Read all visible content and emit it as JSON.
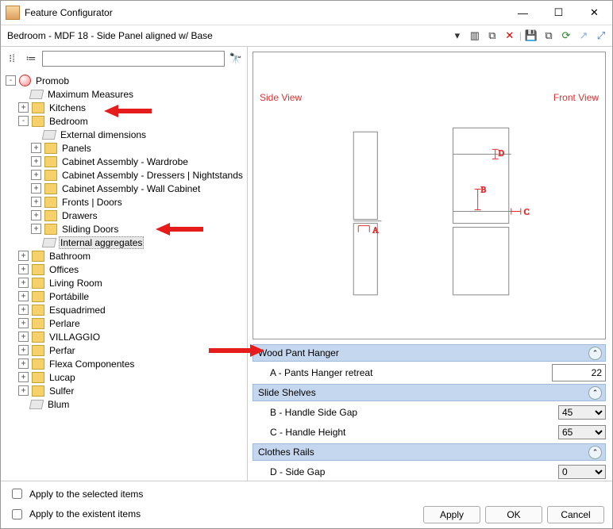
{
  "title": "Feature Configurator",
  "path": "Bedroom - MDF 18 - Side Panel aligned w/ Base",
  "search_placeholder": "",
  "tree": {
    "root": "Promob",
    "items": [
      "Maximum Measures",
      "Kitchens",
      "Bedroom",
      "External dimensions",
      "Panels",
      "Cabinet Assembly - Wardrobe",
      "Cabinet Assembly - Dressers | Nightstands",
      "Cabinet Assembly - Wall Cabinet",
      "Fronts | Doors",
      "Drawers",
      "Sliding Doors",
      "Internal aggregates",
      "Bathroom",
      "Offices",
      "Living Room",
      "Portábille",
      "Esquadrimed",
      "Perlare",
      "VILLAGGIO",
      "Perfar",
      "Flexa Componentes",
      "Lucap",
      "Sulfer",
      "Blum"
    ]
  },
  "preview": {
    "side": "Side View",
    "front": "Front View",
    "labels": [
      "A",
      "B",
      "C",
      "D"
    ]
  },
  "sections": [
    {
      "title": "Wood Pant Hanger",
      "rows": [
        {
          "label": "A - Pants Hanger retreat",
          "value": "22",
          "type": "input"
        }
      ]
    },
    {
      "title": "Slide Shelves",
      "rows": [
        {
          "label": "B - Handle Side Gap",
          "value": "45",
          "type": "select"
        },
        {
          "label": "C - Handle Height",
          "value": "65",
          "type": "select"
        }
      ]
    },
    {
      "title": "Clothes Rails",
      "rows": [
        {
          "label": "D - Side Gap",
          "value": "0",
          "type": "select"
        }
      ]
    }
  ],
  "apply_selected": "Apply to the selected items",
  "apply_existent": "Apply to the existent items",
  "buttons": {
    "apply": "Apply",
    "ok": "OK",
    "cancel": "Cancel"
  }
}
